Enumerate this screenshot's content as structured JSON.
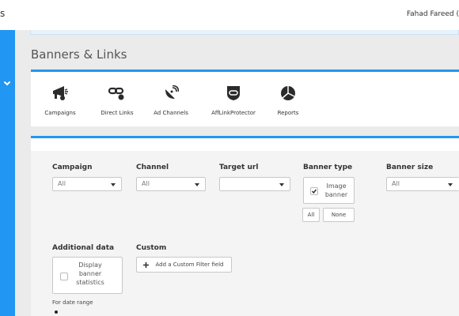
{
  "topbar": {
    "brand_fragment": "s",
    "user_name": "Fahad Fareed ("
  },
  "page": {
    "title": "Banners & Links"
  },
  "nav": {
    "items": [
      {
        "label": "Campaigns",
        "icon": "megaphone-icon"
      },
      {
        "label": "Direct Links",
        "icon": "link-icon"
      },
      {
        "label": "Ad Channels",
        "icon": "satellite-dish-icon"
      },
      {
        "label": "AffLinkProtector",
        "icon": "mask-shield-icon"
      },
      {
        "label": "Reports",
        "icon": "pie-chart-icon"
      }
    ]
  },
  "filters": {
    "campaign": {
      "label": "Campaign",
      "value": "All"
    },
    "channel": {
      "label": "Channel",
      "value": "All"
    },
    "target_url": {
      "label": "Target url",
      "value": ""
    },
    "banner_type": {
      "label": "Banner type",
      "option_label": "Image banner",
      "checked": true,
      "all_label": "All",
      "none_label": "None"
    },
    "banner_size": {
      "label": "Banner size",
      "value": "All"
    },
    "additional_data": {
      "label": "Additional data",
      "option_label": "Display banner statistics",
      "checked": false
    },
    "custom": {
      "label": "Custom",
      "add_button": "Add a Custom Filter field"
    },
    "date_range": {
      "label": "For date range"
    }
  },
  "colors": {
    "accent": "#2196f3",
    "background": "#ebebeb"
  }
}
